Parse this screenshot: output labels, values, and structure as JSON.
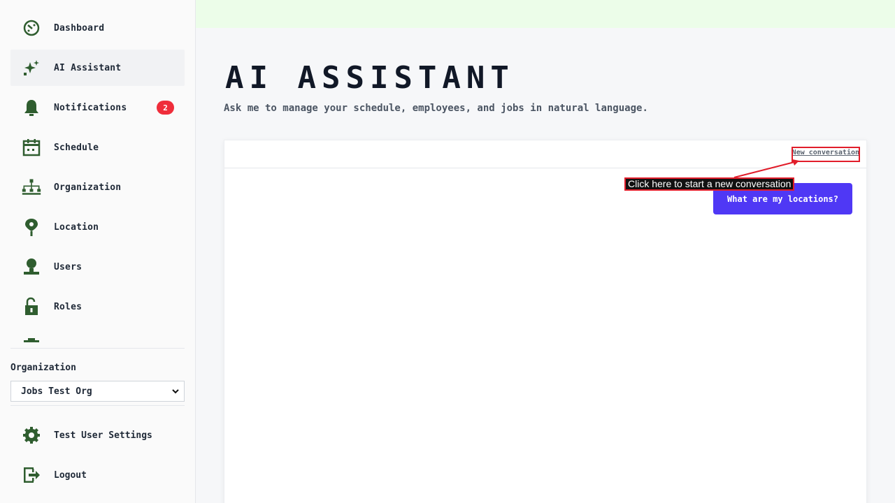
{
  "sidebar": {
    "items": [
      {
        "label": "Dashboard",
        "icon": "dashboard-icon"
      },
      {
        "label": "AI Assistant",
        "icon": "sparkle-icon",
        "active": true
      },
      {
        "label": "Notifications",
        "icon": "bell-icon",
        "badge": "2"
      },
      {
        "label": "Schedule",
        "icon": "calendar-icon"
      },
      {
        "label": "Organization",
        "icon": "org-chart-icon"
      },
      {
        "label": "Location",
        "icon": "location-pin-icon"
      },
      {
        "label": "Users",
        "icon": "user-icon"
      },
      {
        "label": "Roles",
        "icon": "lock-icon"
      }
    ],
    "org_label": "Organization",
    "org_selected": "Jobs Test Org",
    "settings_label": "Test User Settings",
    "logout_label": "Logout"
  },
  "main": {
    "title": "AI Assistant",
    "subtitle": "Ask me to manage your schedule, employees, and jobs in natural language.",
    "new_conversation_label": "New conversation",
    "messages": [
      {
        "role": "user",
        "text": "What are my locations?"
      }
    ]
  },
  "annotation": {
    "tooltip": "Click here to start a new conversation"
  },
  "colors": {
    "icon_green": "#2f5d2f",
    "accent": "#4f38f5",
    "badge": "#ef2d3a",
    "topbar": "#ecfde9",
    "annotation_red": "#e11d2a"
  }
}
